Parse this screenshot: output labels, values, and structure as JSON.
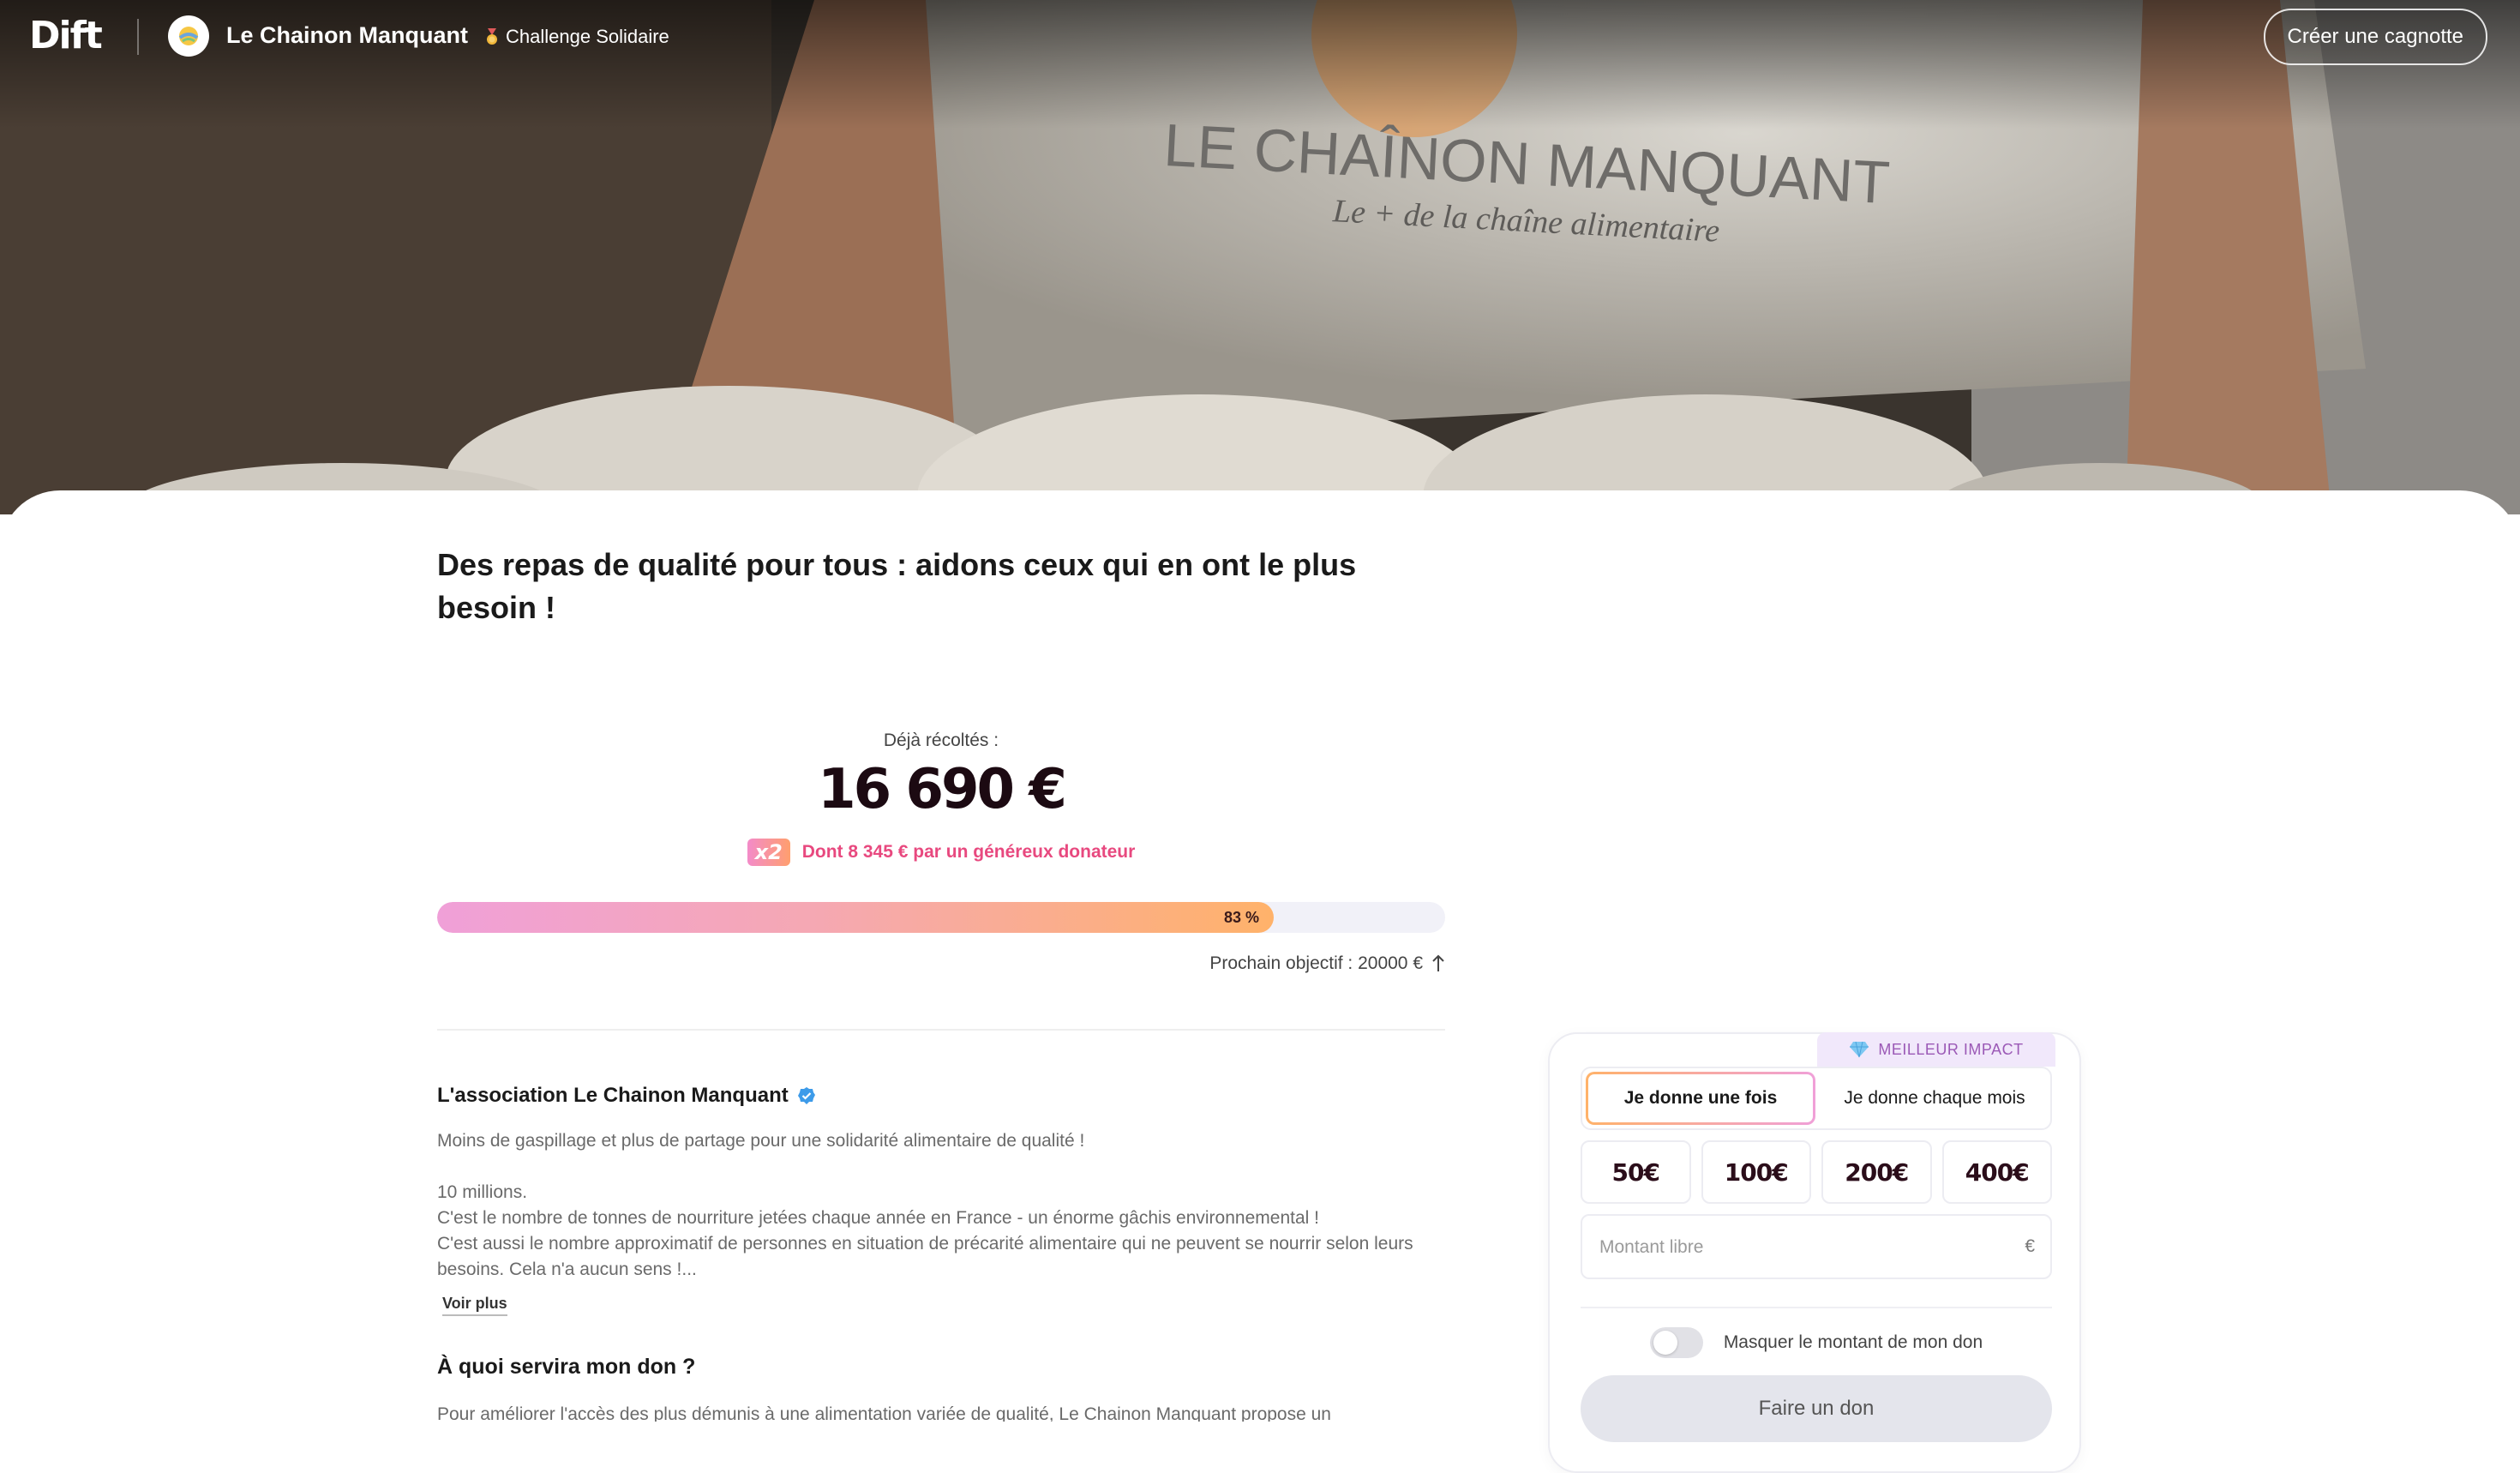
{
  "header": {
    "logo_text": "Dift",
    "org_name": "Le Chainon Manquant",
    "challenge_label": "Challenge Solidaire",
    "create_button": "Créer une cagnotte"
  },
  "hero": {
    "shirt_title": "LE CHAÎNON MANQUANT",
    "shirt_tagline": "Le + de la chaîne alimentaire"
  },
  "campaign": {
    "headline": "Des repas de qualité pour tous : aidons ceux qui en ont le plus besoin !",
    "raised_label": "Déjà récoltés :",
    "raised_amount": "16 690 €",
    "multiplier_badge": "x2",
    "matched_text": "Dont 8 345 € par un généreux donateur",
    "progress_percent": 83,
    "progress_label": "83 %",
    "next_goal": "Prochain objectif : 20000 €"
  },
  "association": {
    "title": "L'association Le Chainon Manquant",
    "paragraphs": [
      "Moins de gaspillage et plus de partage pour une solidarité alimentaire de qualité !",
      "10 millions.",
      "C'est le nombre de tonnes de nourriture jetées chaque année en France - un énorme gâchis environnemental !",
      "C'est aussi le nombre approximatif de personnes en situation de précarité alimentaire qui ne peuvent se nourrir selon leurs besoins. Cela n'a aucun sens !..."
    ],
    "see_more": "Voir plus"
  },
  "usage": {
    "title": "À quoi servira mon don ?",
    "text": "Pour améliorer l'accès des plus démunis à une alimentation variée de qualité, Le Chainon Manquant propose un"
  },
  "donation": {
    "impact_badge": "MEILLEUR IMPACT",
    "freq_once": "Je donne une fois",
    "freq_monthly": "Je donne chaque mois",
    "amounts": [
      "50€",
      "100€",
      "200€",
      "400€"
    ],
    "free_placeholder": "Montant libre",
    "currency": "€",
    "hide_amount_label": "Masquer le montant de mon don",
    "submit": "Faire un don"
  },
  "colors": {
    "accent_pink": "#e8497f",
    "progress_start": "#f0a0d8",
    "progress_end": "#ffb26a",
    "badge_purple": "#9b59b6"
  }
}
